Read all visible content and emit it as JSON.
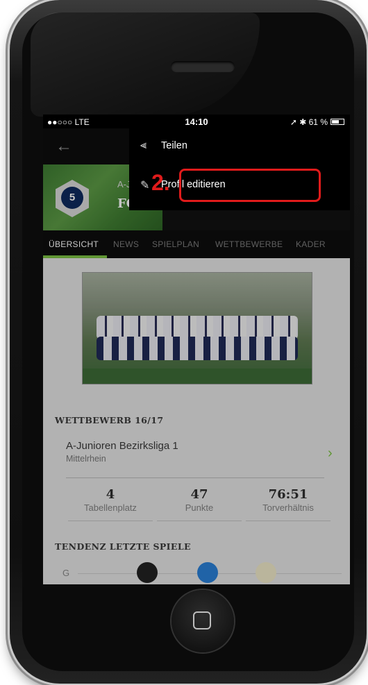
{
  "status_bar": {
    "carrier": "●●○○○ LTE",
    "time": "14:10",
    "right": "➚ ✱ 61 %",
    "battery_level": 0.61
  },
  "menu": {
    "items": [
      {
        "label": "Teilen",
        "icon": "share-icon"
      },
      {
        "label": "Profil editieren",
        "icon": "edit-icon"
      }
    ]
  },
  "annotation": {
    "step": "2."
  },
  "team": {
    "category": "A-Junioren",
    "name": "FC BW"
  },
  "tabs": [
    "ÜBERSICHT",
    "NEWS",
    "SPIELPLAN",
    "WETTBEWERBE",
    "KADER"
  ],
  "competition": {
    "section_title": "WETTBEWERB 16/17",
    "name": "A-Junioren Bezirksliga 1",
    "region": "Mittelrhein",
    "stats": [
      {
        "value": "4",
        "label": "Tabellenplatz"
      },
      {
        "value": "47",
        "label": "Punkte"
      },
      {
        "value": "76:51",
        "label": "Torverhältnis"
      }
    ]
  },
  "tendency": {
    "section_title": "TENDENZ LETZTE SPIELE",
    "first_label": "G"
  },
  "colors": {
    "accent_green": "#7bc043",
    "highlight_red": "#e01b1b"
  }
}
